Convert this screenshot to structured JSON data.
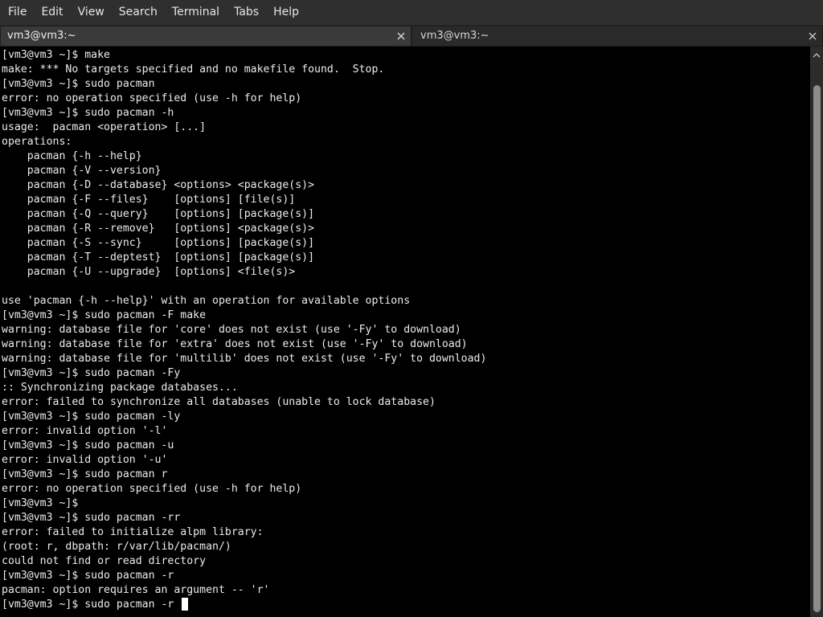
{
  "menu": [
    "File",
    "Edit",
    "View",
    "Search",
    "Terminal",
    "Tabs",
    "Help"
  ],
  "tabs": [
    {
      "title": "vm3@vm3:~",
      "active": true
    },
    {
      "title": "vm3@vm3:~",
      "active": false
    }
  ],
  "icons": {
    "tab_close": "close-icon",
    "scroll_up": "chevron-up-icon"
  },
  "terminal": {
    "lines": [
      "[vm3@vm3 ~]$ make",
      "make: *** No targets specified and no makefile found.  Stop.",
      "[vm3@vm3 ~]$ sudo pacman",
      "error: no operation specified (use -h for help)",
      "[vm3@vm3 ~]$ sudo pacman -h",
      "usage:  pacman <operation> [...]",
      "operations:",
      "    pacman {-h --help}",
      "    pacman {-V --version}",
      "    pacman {-D --database} <options> <package(s)>",
      "    pacman {-F --files}    [options] [file(s)]",
      "    pacman {-Q --query}    [options] [package(s)]",
      "    pacman {-R --remove}   [options] <package(s)>",
      "    pacman {-S --sync}     [options] [package(s)]",
      "    pacman {-T --deptest}  [options] [package(s)]",
      "    pacman {-U --upgrade}  [options] <file(s)>",
      "",
      "use 'pacman {-h --help}' with an operation for available options",
      "[vm3@vm3 ~]$ sudo pacman -F make",
      "warning: database file for 'core' does not exist (use '-Fy' to download)",
      "warning: database file for 'extra' does not exist (use '-Fy' to download)",
      "warning: database file for 'multilib' does not exist (use '-Fy' to download)",
      "[vm3@vm3 ~]$ sudo pacman -Fy",
      ":: Synchronizing package databases...",
      "error: failed to synchronize all databases (unable to lock database)",
      "[vm3@vm3 ~]$ sudo pacman -ly",
      "error: invalid option '-l'",
      "[vm3@vm3 ~]$ sudo pacman -u",
      "error: invalid option '-u'",
      "[vm3@vm3 ~]$ sudo pacman r",
      "error: no operation specified (use -h for help)",
      "[vm3@vm3 ~]$",
      "[vm3@vm3 ~]$ sudo pacman -rr",
      "error: failed to initialize alpm library:",
      "(root: r, dbpath: r/var/lib/pacman/)",
      "could not find or read directory",
      "[vm3@vm3 ~]$ sudo pacman -r",
      "pacman: option requires an argument -- 'r'",
      "[vm3@vm3 ~]$ sudo pacman -r "
    ]
  }
}
